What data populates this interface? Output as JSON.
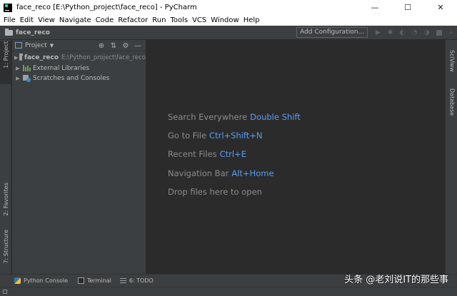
{
  "window": {
    "title": "face_reco [E:\\Python_project\\face_reco] - PyCharm",
    "controls": {
      "minimize": "—",
      "maximize": "☐",
      "close": "✕"
    }
  },
  "menu": [
    "File",
    "Edit",
    "View",
    "Navigate",
    "Code",
    "Refactor",
    "Run",
    "Tools",
    "VCS",
    "Window",
    "Help"
  ],
  "navbar": {
    "project": "face_reco",
    "add_configuration": "Add Configuration..."
  },
  "left_tabs": {
    "project": "1: Project",
    "favorites": "2: Favorites",
    "structure": "7: Structure"
  },
  "right_tabs": {
    "sciview": "SciView",
    "database": "Database"
  },
  "project_panel": {
    "title": "Project",
    "tree": [
      {
        "name": "face_reco",
        "path": "E:\\Python_project\\face_reco"
      },
      {
        "name": "External Libraries"
      },
      {
        "name": "Scratches and Consoles"
      }
    ]
  },
  "editor_hints": [
    {
      "label": "Search Everywhere",
      "key": "Double Shift"
    },
    {
      "label": "Go to File",
      "key": "Ctrl+Shift+N"
    },
    {
      "label": "Recent Files",
      "key": "Ctrl+E"
    },
    {
      "label": "Navigation Bar",
      "key": "Alt+Home"
    },
    {
      "label": "Drop files here to open",
      "key": ""
    }
  ],
  "bottom_tabs": {
    "python_console": "Python Console",
    "terminal": "Terminal",
    "todo": "6: TODO"
  },
  "watermark": "头条 @老刘说IT的那些事",
  "colors": {
    "accent_key": "#589df6",
    "editor_bg": "#2b2b2b",
    "panel_bg": "#3c3f41"
  }
}
